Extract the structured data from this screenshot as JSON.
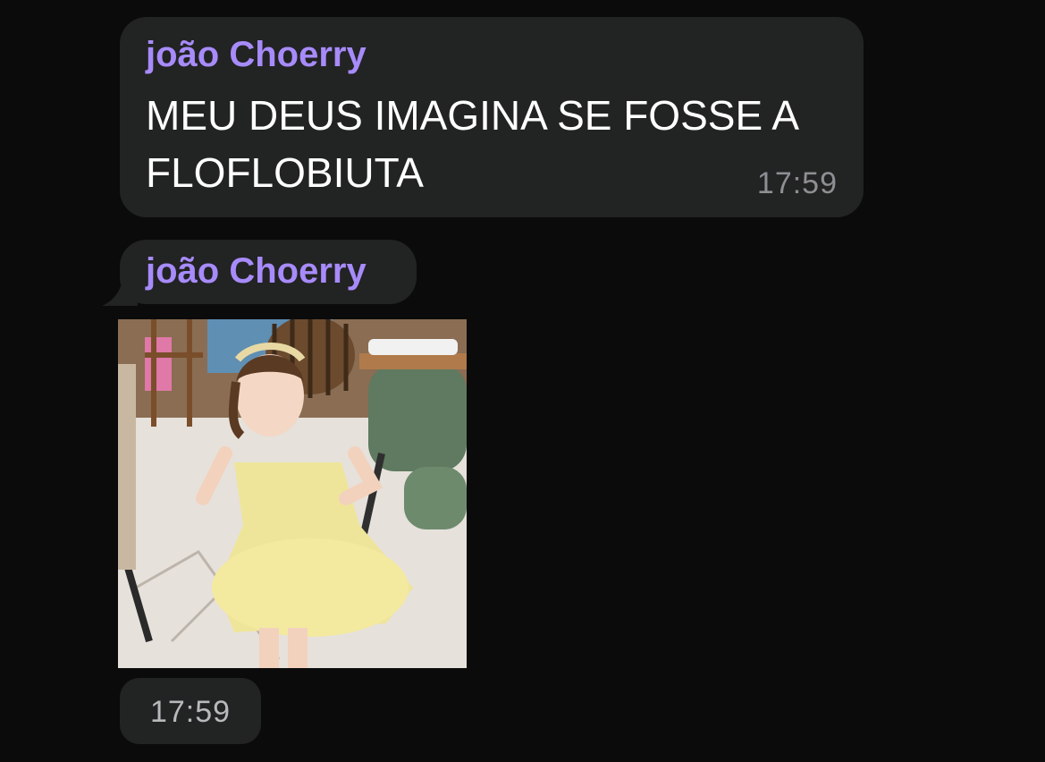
{
  "messages": [
    {
      "sender": "joão Choerry",
      "text": "MEU DEUS IMAGINA SE FOSSE A FLOFLOBIUTA",
      "time": "17:59"
    },
    {
      "sender": "joão Choerry",
      "media": "video-thumbnail",
      "time": "17:59"
    }
  ],
  "colors": {
    "background": "#0b0b0b",
    "bubble": "#222323",
    "sender_name": "#a78bfa",
    "message_text": "#ffffff",
    "timestamp": "#8e8e93"
  }
}
